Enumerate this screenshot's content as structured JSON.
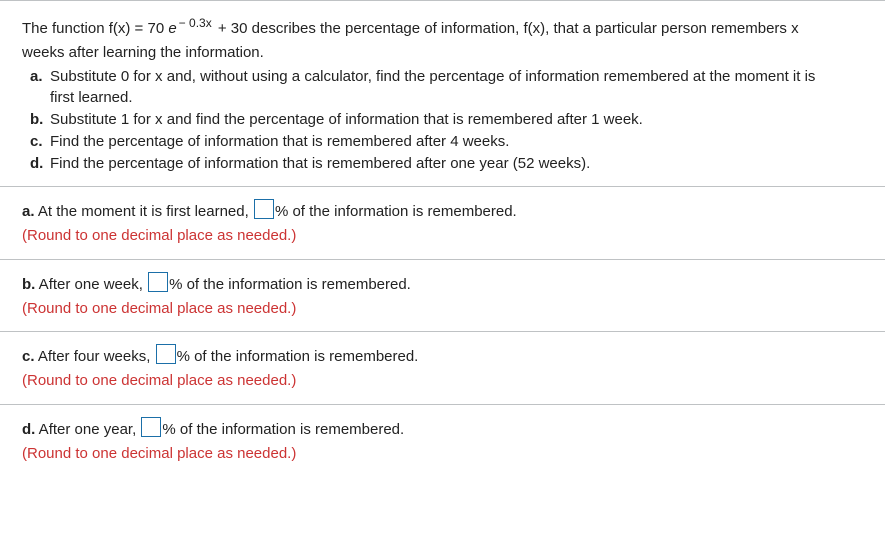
{
  "stem": {
    "line1a": "The function f(x) = 70",
    "em": "e",
    "exp": "− 0.3x",
    "line1b": " + 30 describes the percentage of information, f(x), that a particular person remembers x",
    "line2": "weeks after learning the information.",
    "items": {
      "a": {
        "label": "a.",
        "text1": "Substitute 0 for x and, without using a calculator, find the percentage of information remembered at the moment it is",
        "text2": "first learned."
      },
      "b": {
        "label": "b.",
        "text": "Substitute 1 for x and find the percentage of information that is remembered after 1 week."
      },
      "c": {
        "label": "c.",
        "text": "Find the percentage of information that is remembered after 4 weeks."
      },
      "d": {
        "label": "d.",
        "text": "Find the percentage of information that is remembered after one year (52 weeks)."
      }
    }
  },
  "parts": {
    "a": {
      "label": "a.",
      "before": " At the moment it is first learned, ",
      "after": "% of the information is remembered.",
      "round": "(Round to one decimal place as needed.)"
    },
    "b": {
      "label": "b.",
      "before": " After one week, ",
      "after": "% of the information is remembered.",
      "round": "(Round to one decimal place as needed.)"
    },
    "c": {
      "label": "c.",
      "before": " After four weeks, ",
      "after": "% of the information is remembered.",
      "round": "(Round to one decimal place as needed.)"
    },
    "d": {
      "label": "d.",
      "before": " After one year, ",
      "after": "% of the information is remembered.",
      "round": "(Round to one decimal place as needed.)"
    }
  }
}
